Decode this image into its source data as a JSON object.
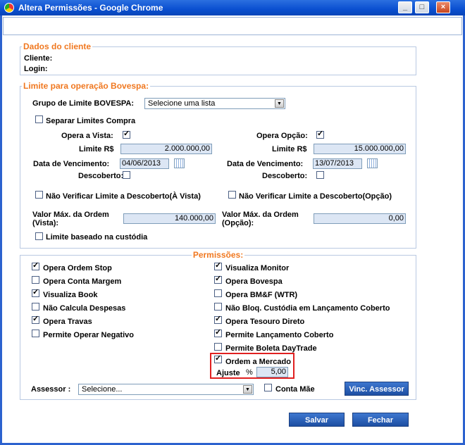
{
  "window": {
    "title": "Altera Permissões - Google Chrome",
    "minimize": "_",
    "maximize": "□",
    "close": "×"
  },
  "dados": {
    "legend": "Dados do cliente",
    "cliente_label": "Cliente:",
    "login_label": "Login:"
  },
  "limite": {
    "legend": "Limite para operação Bovespa:",
    "grupo_label": "Grupo de Limite BOVESPA:",
    "grupo_value": "Selecione uma lista",
    "separar_label": "Separar Limites Compra",
    "opera_vista_label": "Opera a Vista:",
    "opera_opcao_label": "Opera Opção:",
    "limite_label_left": "Limite R$",
    "limite_value_left": "2.000.000,00",
    "limite_label_right": "Limite R$",
    "limite_value_right": "15.000.000,00",
    "venc_label_left": "Data de Vencimento:",
    "venc_value_left": "04/06/2013",
    "venc_label_right": "Data de Vencimento:",
    "venc_value_right": "13/07/2013",
    "descoberto_left": "Descoberto:",
    "descoberto_right": "Descoberto:",
    "nao_verif_vista": "Não Verificar Limite a Descoberto(À Vista)",
    "nao_verif_opcao": "Não Verificar Limite a Descoberto(Opção)",
    "valor_max_vista_l1": "Valor Máx. da Ordem",
    "valor_max_vista_l2": "(Vista):",
    "valor_max_vista_value": "140.000,00",
    "valor_max_opcao_l1": "Valor Máx. da Ordem",
    "valor_max_opcao_l2": "(Opção):",
    "valor_max_opcao_value": "0,00",
    "custodia_label": "Limite baseado na custódia"
  },
  "permissoes": {
    "legend": "Permissões:",
    "left": [
      {
        "label": "Opera Ordem Stop",
        "checked": true
      },
      {
        "label": "Opera Conta Margem",
        "checked": false
      },
      {
        "label": "Visualiza Book",
        "checked": true
      },
      {
        "label": "Não Calcula Despesas",
        "checked": false
      },
      {
        "label": "Opera Travas",
        "checked": true
      },
      {
        "label": "Permite Operar Negativo",
        "checked": false
      }
    ],
    "right": [
      {
        "label": "Visualiza Monitor",
        "checked": true
      },
      {
        "label": "Opera Bovespa",
        "checked": true
      },
      {
        "label": "Opera BM&F (WTR)",
        "checked": false
      },
      {
        "label": "Não Bloq. Custódia em Lançamento Coberto",
        "checked": false
      },
      {
        "label": "Opera Tesouro Direto",
        "checked": true
      },
      {
        "label": "Permite Lançamento Coberto",
        "checked": true
      },
      {
        "label": "Permite Boleta DayTrade",
        "checked": false
      }
    ],
    "ordem_mercado": "Ordem a Mercado",
    "ajuste_label": "Ajuste",
    "ajuste_unit": "%",
    "ajuste_value": "5,00",
    "highlight_color": "#e02020"
  },
  "assessor": {
    "label": "Assessor :",
    "value": "Selecione...",
    "conta_mae": "Conta Mãe",
    "vinc_button": "Vinc. Assessor"
  },
  "footer": {
    "salvar": "Salvar",
    "fechar": "Fechar"
  }
}
